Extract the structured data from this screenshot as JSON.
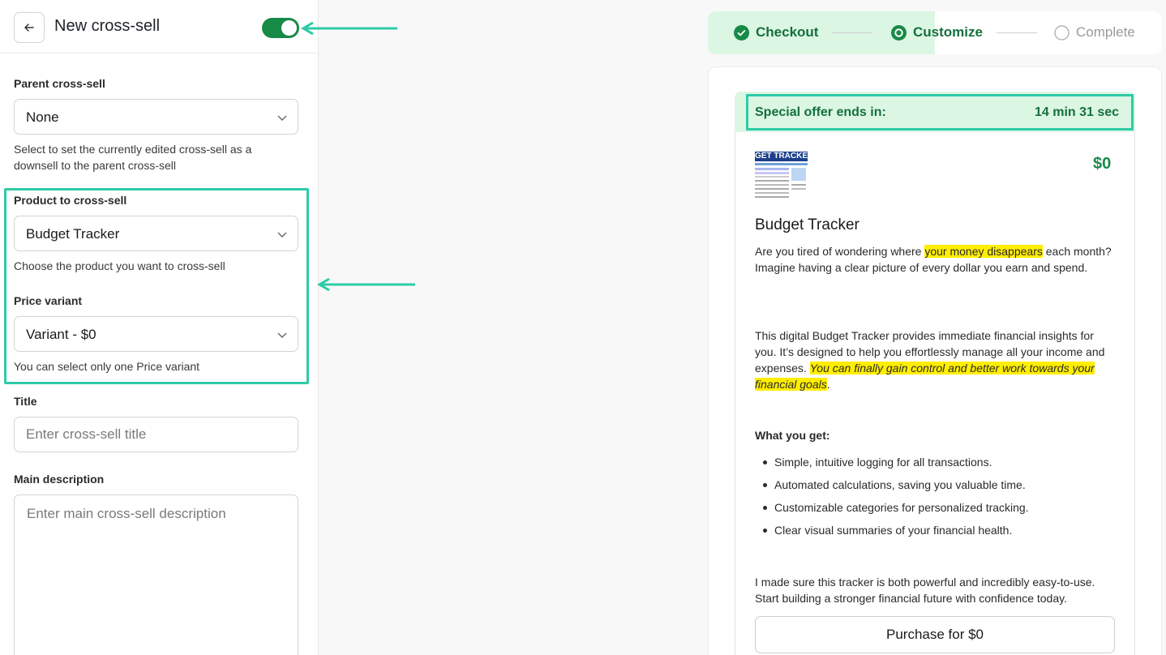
{
  "header": {
    "title": "New cross-sell",
    "enabled": true
  },
  "form": {
    "parent": {
      "label": "Parent cross-sell",
      "value": "None",
      "help": "Select to set the currently edited cross-sell as a downsell to the parent cross-sell"
    },
    "product": {
      "label": "Product to cross-sell",
      "value": "Budget Tracker",
      "help": "Choose the product you want to cross-sell"
    },
    "variant": {
      "label": "Price variant",
      "value": "Variant - $0",
      "help": "You can select only one Price variant"
    },
    "title": {
      "label": "Title",
      "placeholder": "Enter cross-sell title",
      "value": ""
    },
    "description": {
      "label": "Main description",
      "placeholder": "Enter main cross-sell description",
      "value": ""
    }
  },
  "stepper": {
    "steps": [
      {
        "label": "Checkout",
        "state": "done"
      },
      {
        "label": "Customize",
        "state": "current"
      },
      {
        "label": "Complete",
        "state": "pending"
      }
    ]
  },
  "preview": {
    "offer_label": "Special offer ends in:",
    "offer_time": "14 min 31 sec",
    "thumbnail_text": "GET TRACKER",
    "price": "$0",
    "product_name": "Budget Tracker",
    "para1_before": "Are you tired of wondering where ",
    "para1_mark": "your money disappears",
    "para1_after": " each month? Imagine having a clear picture of every dollar you earn and spend.",
    "para2_before": "This digital Budget Tracker provides immediate financial insights for you. It’s designed to help you effortlessly manage all your income and expenses. ",
    "para2_mark": "You can finally gain control and better work towards your financial goals",
    "para2_after": ".",
    "what_you_get": "What you get:",
    "bullets": [
      "Simple, intuitive logging for all transactions.",
      "Automated calculations, saving you valuable time.",
      "Customizable categories for personalized tracking.",
      "Clear visual summaries of your financial health."
    ],
    "closing": "I made sure this tracker is both powerful and incredibly easy-to-use. Start building a stronger financial future with confidence today.",
    "purchase_label": "Purchase for $0"
  },
  "colors": {
    "accent_green": "#188a48",
    "highlight_teal": "#2ecba8",
    "stepper_bg": "#dcf6e4",
    "text_mark": "#ffee00"
  }
}
